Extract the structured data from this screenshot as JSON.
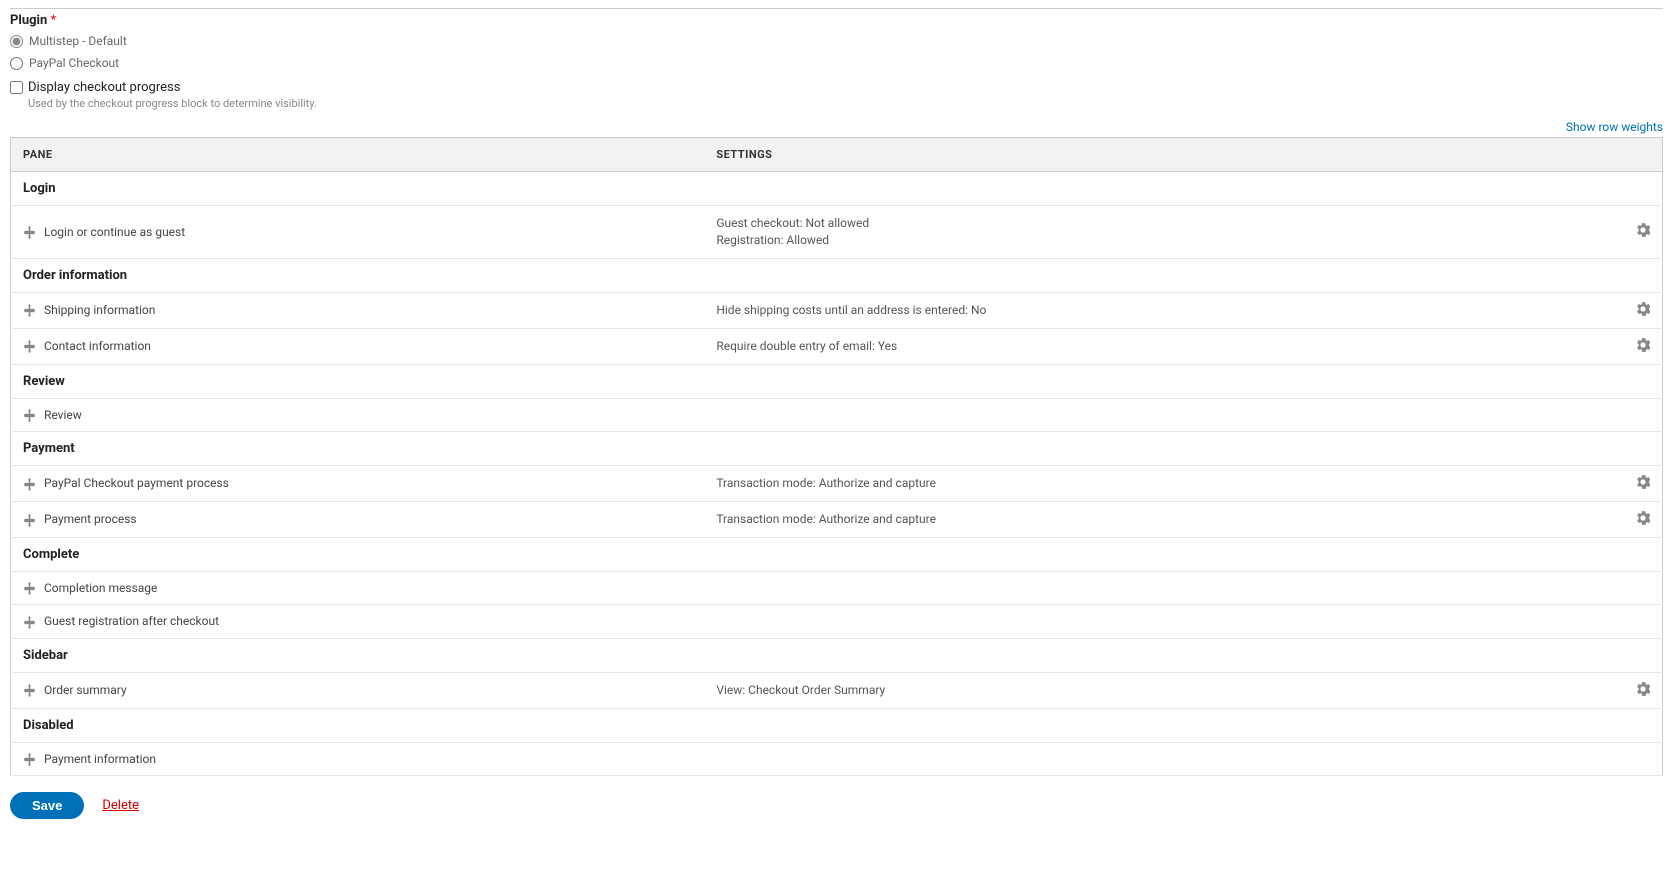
{
  "plugin": {
    "label": "Plugin",
    "required_mark": "*",
    "options": [
      {
        "label": "Multistep - Default",
        "checked": true
      },
      {
        "label": "PayPal Checkout",
        "checked": false
      }
    ]
  },
  "progress_checkbox": {
    "label": "Display checkout progress",
    "help": "Used by the checkout progress block to determine visibility."
  },
  "show_weights": "Show row weights",
  "table": {
    "headers": {
      "pane": "PANE",
      "settings": "SETTINGS"
    },
    "sections": [
      {
        "title": "Login",
        "rows": [
          {
            "name": "Login or continue as guest",
            "settings": "Guest checkout: Not allowed\nRegistration: Allowed",
            "gear": true
          }
        ]
      },
      {
        "title": "Order information",
        "rows": [
          {
            "name": "Shipping information",
            "settings": "Hide shipping costs until an address is entered: No",
            "gear": true
          },
          {
            "name": "Contact information",
            "settings": "Require double entry of email: Yes",
            "gear": true
          }
        ]
      },
      {
        "title": "Review",
        "rows": [
          {
            "name": "Review",
            "settings": "",
            "gear": false
          }
        ]
      },
      {
        "title": "Payment",
        "rows": [
          {
            "name": "PayPal Checkout payment process",
            "settings": "Transaction mode: Authorize and capture",
            "gear": true
          },
          {
            "name": "Payment process",
            "settings": "Transaction mode: Authorize and capture",
            "gear": true
          }
        ]
      },
      {
        "title": "Complete",
        "rows": [
          {
            "name": "Completion message",
            "settings": "",
            "gear": false
          },
          {
            "name": "Guest registration after checkout",
            "settings": "",
            "gear": false
          }
        ]
      },
      {
        "title": "Sidebar",
        "rows": [
          {
            "name": "Order summary",
            "settings": "View: Checkout Order Summary",
            "gear": true
          }
        ]
      },
      {
        "title": "Disabled",
        "rows": [
          {
            "name": "Payment information",
            "settings": "",
            "gear": false
          }
        ]
      }
    ]
  },
  "actions": {
    "save": "Save",
    "delete": "Delete"
  }
}
